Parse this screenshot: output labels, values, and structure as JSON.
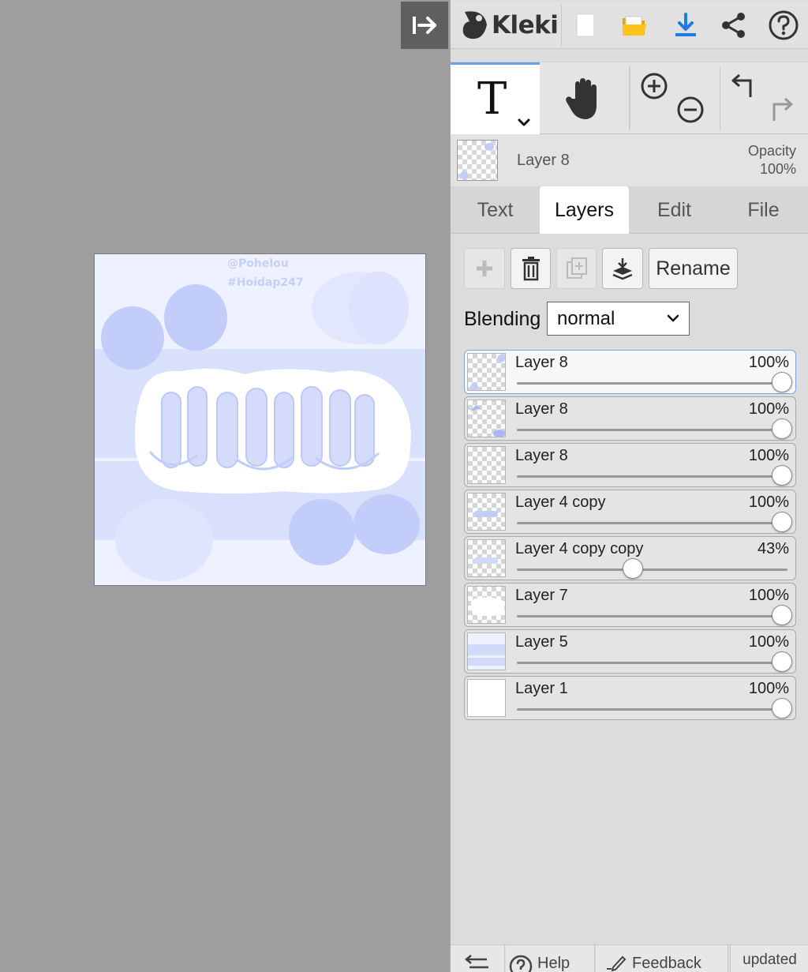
{
  "app": {
    "name": "Kleki"
  },
  "canvas": {
    "watermark_line1": "@Pohelou",
    "watermark_line2": "#Hoidap247",
    "colors": {
      "background": "#eef1ff",
      "band": "#d9e0fc",
      "blob": "#c3cdfa",
      "blob_light": "#dfe5fd"
    }
  },
  "top_bar": {
    "icons": [
      "collapse-panel-icon",
      "kleki-logo-icon",
      "new-image-icon",
      "open-folder-icon",
      "download-icon",
      "share-icon",
      "help-icon"
    ],
    "accent": "#1e7ae6"
  },
  "tools": {
    "active_tool": "text",
    "icons": [
      "text-tool-icon",
      "hand-tool-icon",
      "zoom-in-icon",
      "zoom-out-icon",
      "undo-icon",
      "redo-icon"
    ]
  },
  "active_layer": {
    "name": "Layer 8",
    "opacity_label": "Opacity",
    "opacity_value": "100%"
  },
  "tabs": [
    {
      "label": "Text",
      "active": false
    },
    {
      "label": "Layers",
      "active": true
    },
    {
      "label": "Edit",
      "active": false
    },
    {
      "label": "File",
      "active": false
    }
  ],
  "layer_controls": {
    "rename_label": "Rename",
    "blending_label": "Blending",
    "blending_value": "normal"
  },
  "layers": [
    {
      "name": "Layer 8",
      "opacity": "100%",
      "opacity_value": 1.0,
      "selected": true
    },
    {
      "name": "Layer 8",
      "opacity": "100%",
      "opacity_value": 1.0,
      "selected": false
    },
    {
      "name": "Layer 8",
      "opacity": "100%",
      "opacity_value": 1.0,
      "selected": false
    },
    {
      "name": "Layer 4 copy",
      "opacity": "100%",
      "opacity_value": 1.0,
      "selected": false
    },
    {
      "name": "Layer 4 copy copy",
      "opacity": "43%",
      "opacity_value": 0.43,
      "selected": false
    },
    {
      "name": "Layer 7",
      "opacity": "100%",
      "opacity_value": 1.0,
      "selected": false
    },
    {
      "name": "Layer 5",
      "opacity": "100%",
      "opacity_value": 1.0,
      "selected": false
    },
    {
      "name": "Layer 1",
      "opacity": "100%",
      "opacity_value": 1.0,
      "selected": false
    }
  ],
  "bottom_bar": {
    "help_label": "Help",
    "feedback_label": "Feedback",
    "updated_label": "updated"
  }
}
